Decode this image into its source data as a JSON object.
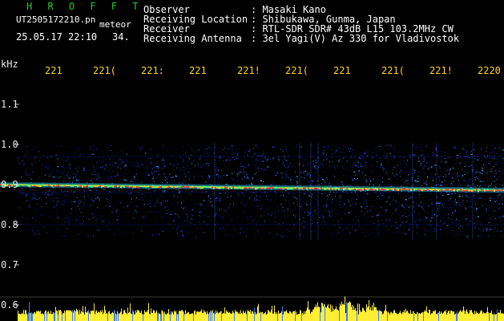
{
  "header": {
    "app_title": "H R O F F T",
    "filename": "UT2505172210.pn",
    "event_tag": "meteor",
    "datetime": "25.05.17 22:10",
    "seconds": "34.",
    "info_labels": [
      "Observer",
      "Receiving Location",
      "Receiver",
      "Receiving Antenna"
    ],
    "info_values": [
      ": Masaki Kano",
      ": Shibukawa, Gunma, Japan",
      ": RTL-SDR SDR# 43dB L15 103.2MHz CW",
      ": 3el Yagi(V) Az 330 for Vladivostok"
    ]
  },
  "colors": {
    "background": "#000000",
    "signal_line": "#ff3030",
    "noise_mid": "#2f7bff",
    "bottom_meter": "#ffee33",
    "text_header": "#ffffff",
    "text_app": "#22cc22",
    "text_axis_x": "#ffd21a"
  },
  "chart_data": {
    "type": "heatmap",
    "ylabel": "kHz",
    "y_ticks": [
      "1.1",
      "1.0",
      "0.9",
      "0.8",
      "0.7",
      "0.6"
    ],
    "y_range": [
      0.6,
      1.15
    ],
    "x_ticks": [
      "221",
      "221(",
      "221:",
      "221",
      "221!",
      "221(",
      "221",
      "221(",
      "221!",
      "2220"
    ],
    "carrier_khz": 0.9,
    "noise_band_khz": [
      0.77,
      1.0
    ]
  }
}
